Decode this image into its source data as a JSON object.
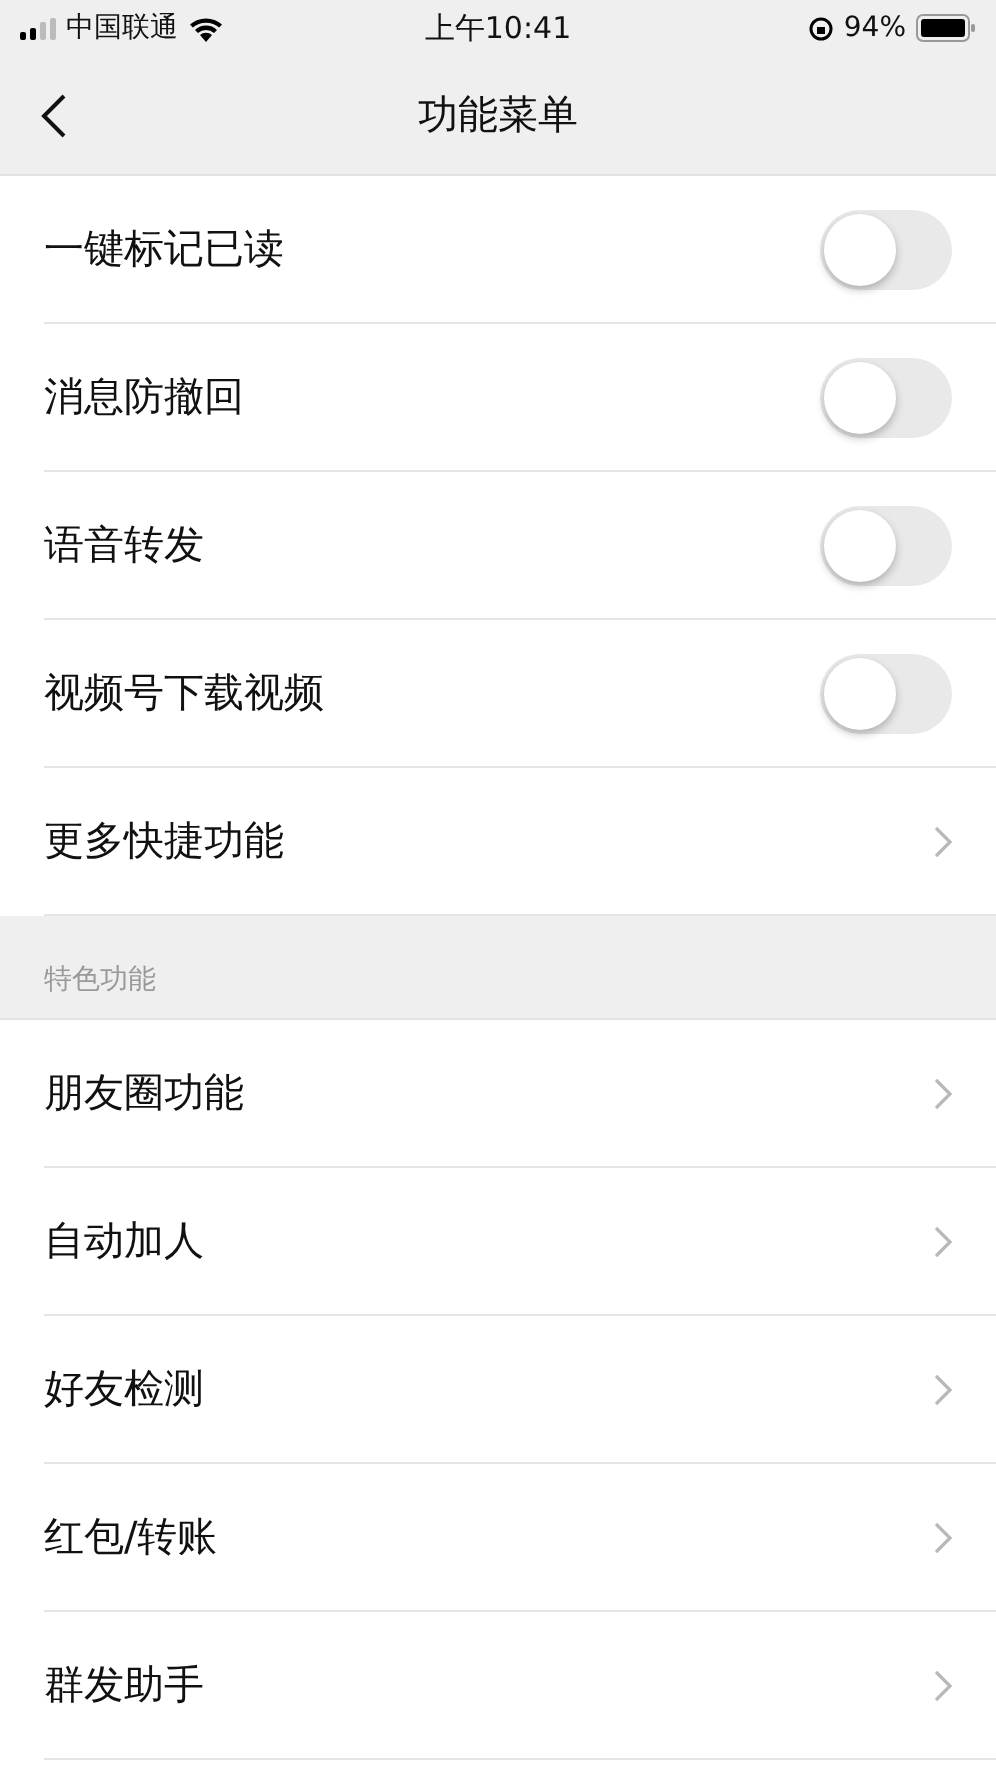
{
  "status_bar": {
    "carrier": "中国联通",
    "time": "上午10:41",
    "battery": "94%"
  },
  "nav": {
    "title": "功能菜单"
  },
  "items": [
    {
      "kind": "toggle",
      "label": "一键标记已读",
      "on": false
    },
    {
      "kind": "toggle",
      "label": "消息防撤回",
      "on": false
    },
    {
      "kind": "toggle",
      "label": "语音转发",
      "on": false
    },
    {
      "kind": "toggle",
      "label": "视频号下载视频",
      "on": false
    },
    {
      "kind": "link",
      "label": "更多快捷功能"
    }
  ],
  "section": {
    "title": "特色功能",
    "items": [
      {
        "kind": "link",
        "label": "朋友圈功能"
      },
      {
        "kind": "link",
        "label": "自动加人"
      },
      {
        "kind": "link",
        "label": "好友检测"
      },
      {
        "kind": "link",
        "label": "红包/转账"
      },
      {
        "kind": "link",
        "label": "群发助手"
      }
    ]
  }
}
